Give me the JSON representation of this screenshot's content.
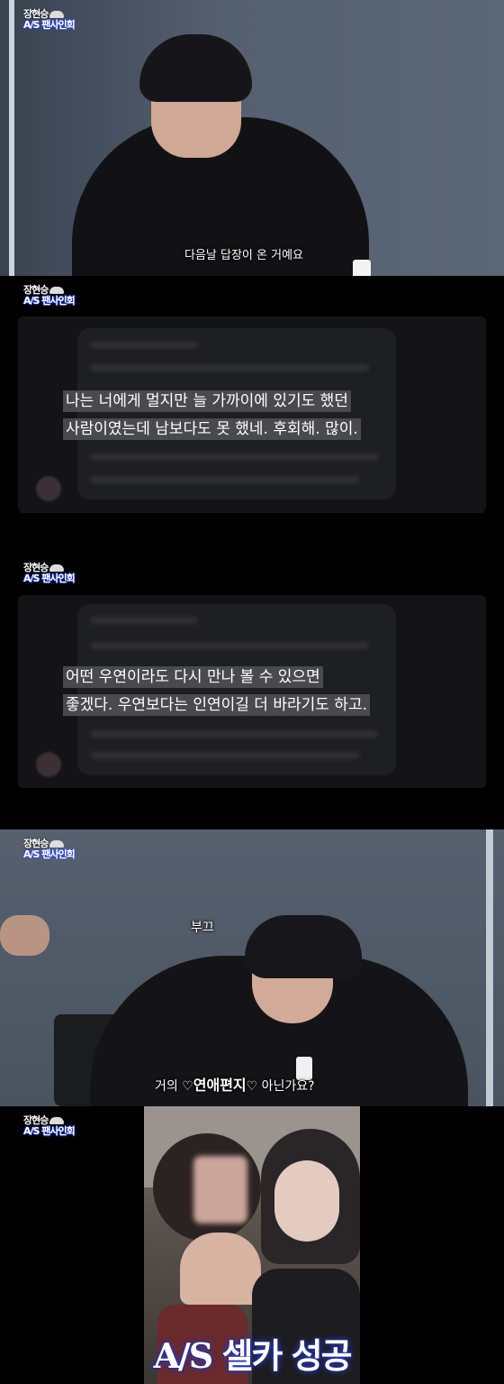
{
  "logo": {
    "line1": "장현승",
    "line2": "A/S 팬사인회"
  },
  "panel1": {
    "subtitle": "다음날 답장이 온 거예요"
  },
  "panel2": {
    "highlight_lines": [
      "나는 너에게 멀지만 늘 가까이에 있기도 했던",
      "사람이였는데 남보다도 못 했네. 후회해. 많이."
    ]
  },
  "panel3": {
    "highlight_lines": [
      "어떤 우연이라도 다시 만나 볼 수 있으면",
      "좋겠다. 우연보다는 인연이길 더 바라기도 하고."
    ]
  },
  "panel4": {
    "caption_top": "부끄",
    "subtitle_prefix": "거의 ♡",
    "subtitle_bold": "연애편지",
    "subtitle_suffix": "♡ 아닌가요?"
  },
  "panel5": {
    "title": "A/S 셀카 성공"
  },
  "colors": {
    "logo_glow": "#2a4cff",
    "title_glow": "#2b3bb8"
  }
}
